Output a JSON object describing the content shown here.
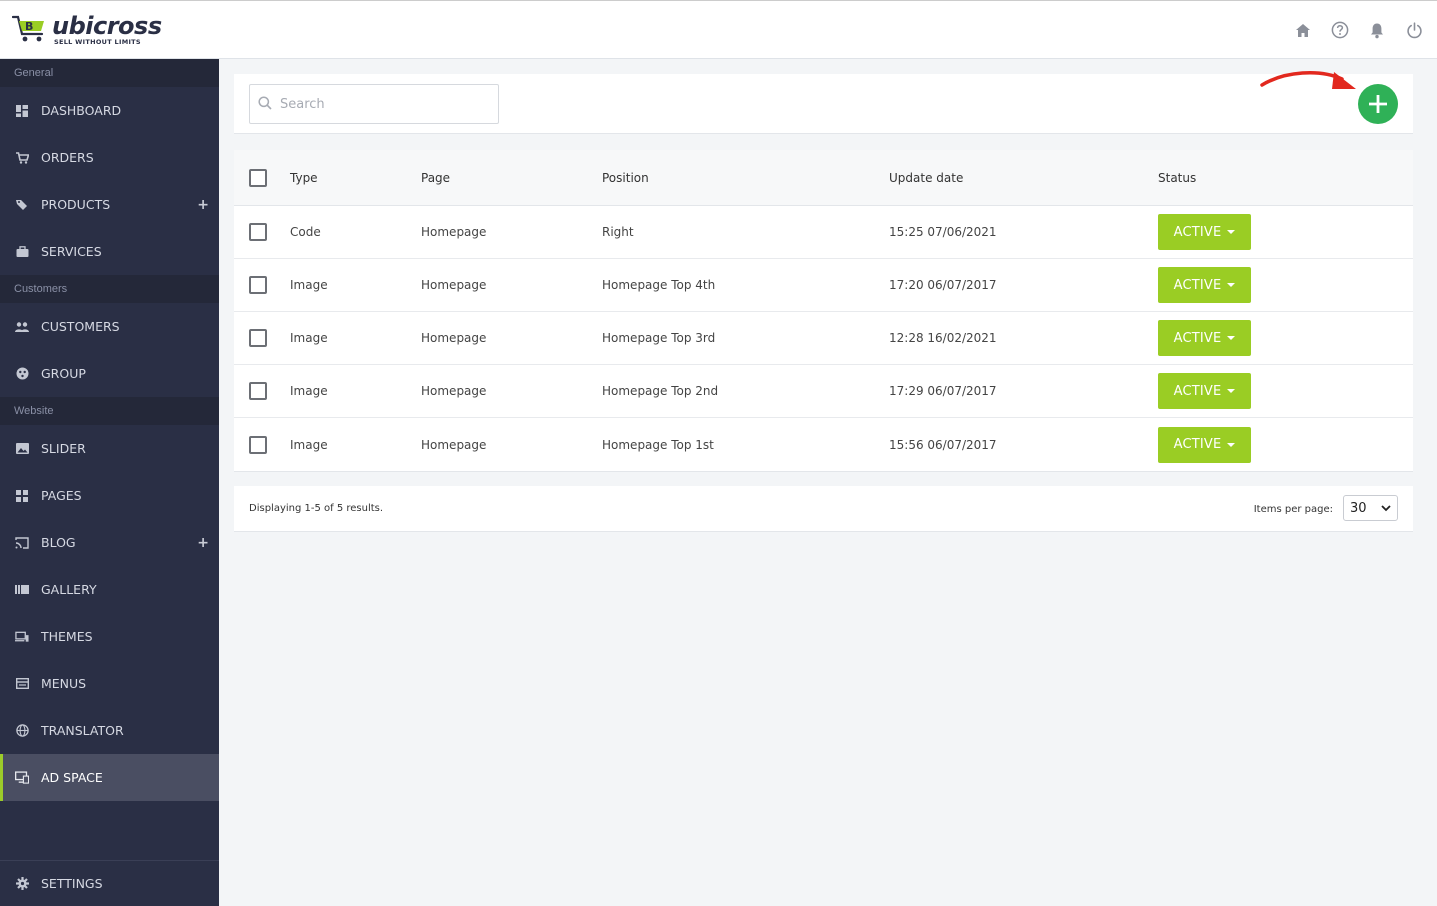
{
  "brand": {
    "name": "ubicross",
    "tagline": "SELL WITHOUT LIMITS",
    "accent_green": "#9acd24",
    "add_green": "#2fb157",
    "sidebar_bg": "#2a2f45"
  },
  "header": {
    "icons": [
      "home-icon",
      "help-icon",
      "bell-icon",
      "power-icon"
    ]
  },
  "sidebar": {
    "sections": [
      {
        "label": "General",
        "items": [
          {
            "label": "DASHBOARD",
            "icon": "dashboard-icon"
          },
          {
            "label": "ORDERS",
            "icon": "cart-icon"
          },
          {
            "label": "PRODUCTS",
            "icon": "tag-icon",
            "expandable": true
          },
          {
            "label": "SERVICES",
            "icon": "briefcase-icon"
          }
        ]
      },
      {
        "label": "Customers",
        "items": [
          {
            "label": "CUSTOMERS",
            "icon": "users-icon"
          },
          {
            "label": "GROUP",
            "icon": "group-icon"
          }
        ]
      },
      {
        "label": "Website",
        "items": [
          {
            "label": "SLIDER",
            "icon": "image-icon"
          },
          {
            "label": "PAGES",
            "icon": "pages-icon"
          },
          {
            "label": "BLOG",
            "icon": "cast-icon",
            "expandable": true
          },
          {
            "label": "GALLERY",
            "icon": "gallery-icon"
          },
          {
            "label": "THEMES",
            "icon": "devices-icon"
          },
          {
            "label": "MENUS",
            "icon": "menu-icon"
          },
          {
            "label": "TRANSLATOR",
            "icon": "globe-icon"
          },
          {
            "label": "AD SPACE",
            "icon": "ad-icon",
            "active": true
          }
        ]
      }
    ],
    "settings_label": "SETTINGS"
  },
  "toolbar": {
    "search_placeholder": "Search"
  },
  "table": {
    "headers": {
      "type": "Type",
      "page": "Page",
      "position": "Position",
      "update_date": "Update date",
      "status": "Status"
    },
    "rows": [
      {
        "type": "Code",
        "page": "Homepage",
        "position": "Right",
        "update_date": "15:25 07/06/2021",
        "status": "ACTIVE"
      },
      {
        "type": "Image",
        "page": "Homepage",
        "position": "Homepage Top 4th",
        "update_date": "17:20 06/07/2017",
        "status": "ACTIVE"
      },
      {
        "type": "Image",
        "page": "Homepage",
        "position": "Homepage Top 3rd",
        "update_date": "12:28 16/02/2021",
        "status": "ACTIVE"
      },
      {
        "type": "Image",
        "page": "Homepage",
        "position": "Homepage Top 2nd",
        "update_date": "17:29 06/07/2017",
        "status": "ACTIVE"
      },
      {
        "type": "Image",
        "page": "Homepage",
        "position": "Homepage Top 1st",
        "update_date": "15:56 06/07/2017",
        "status": "ACTIVE"
      }
    ]
  },
  "footer": {
    "display_text": "Displaying 1-5 of 5 results.",
    "items_per_page_label": "Items per page:",
    "items_per_page_value": "30"
  }
}
